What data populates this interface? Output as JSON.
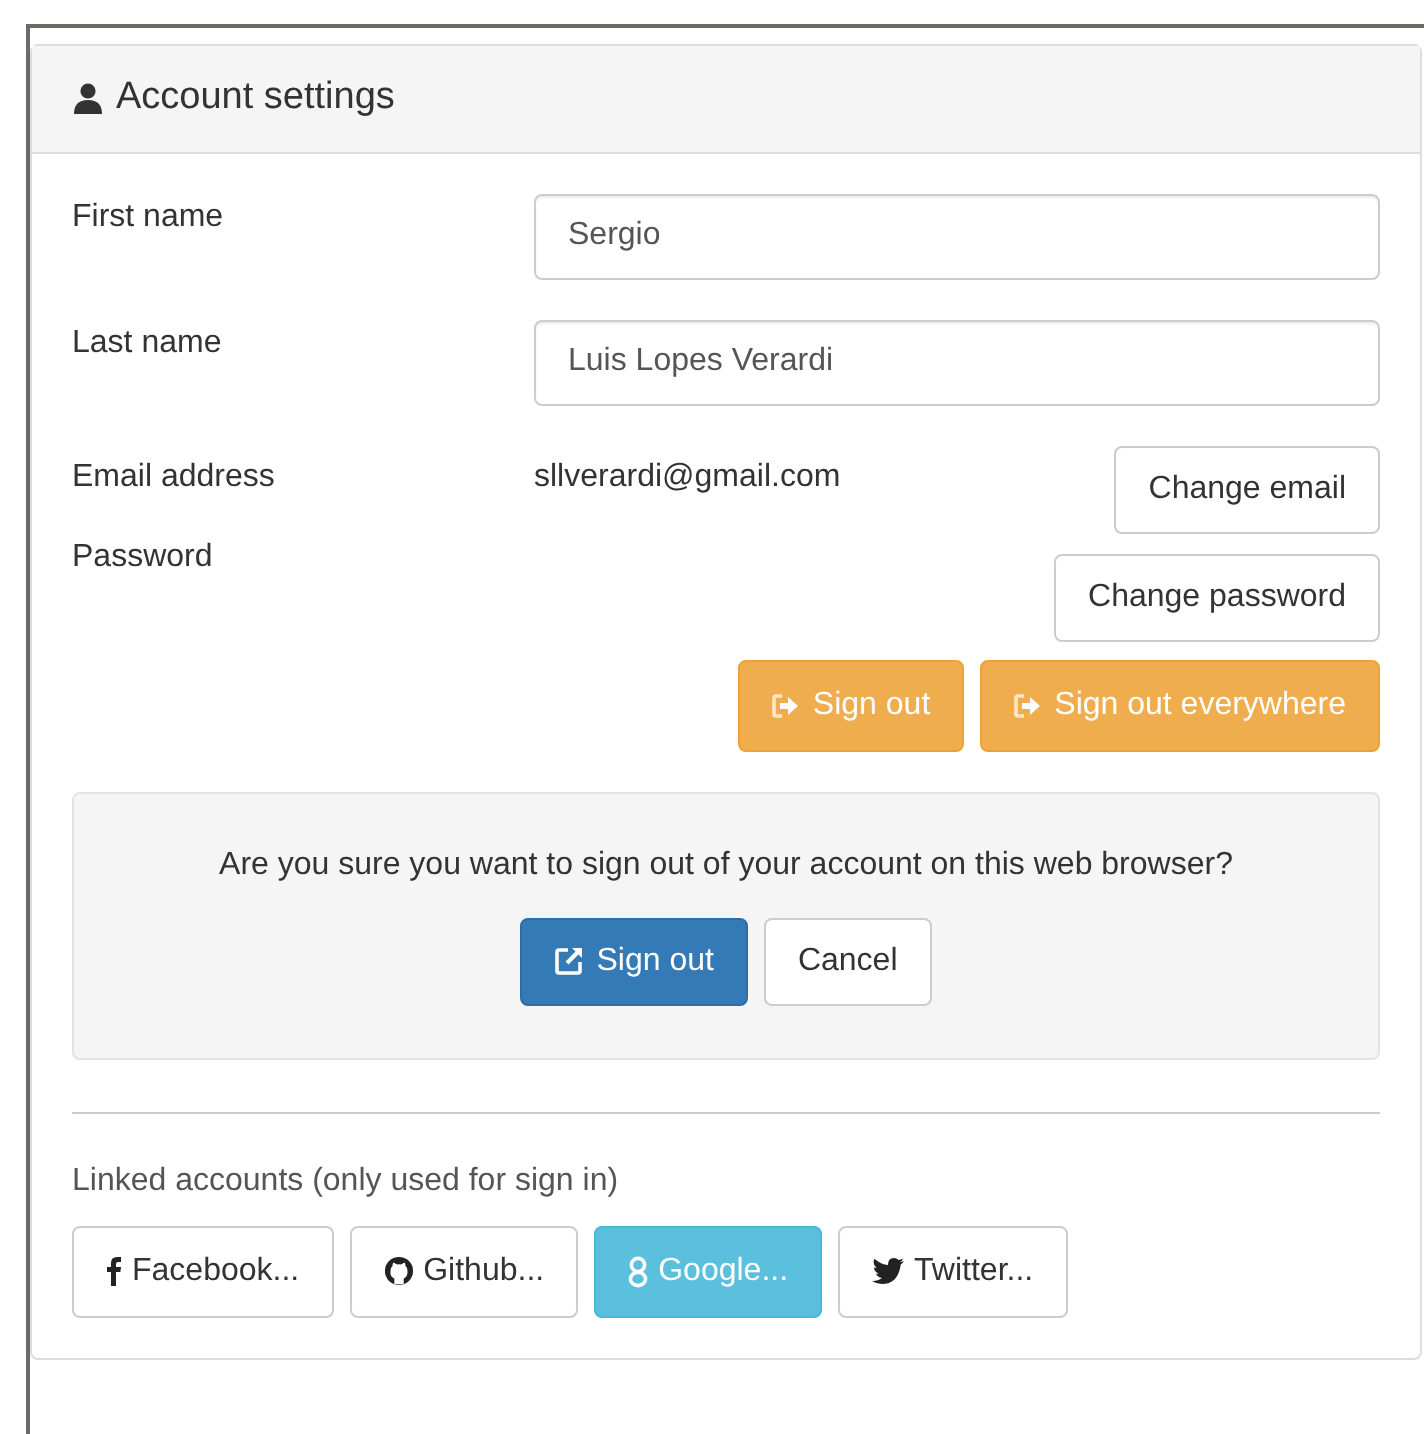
{
  "panel": {
    "title": "Account settings"
  },
  "fields": [
    {
      "label": "First name",
      "value": "Sergio"
    },
    {
      "label": "Last name",
      "value": "Luis Lopes Verardi"
    }
  ],
  "email": {
    "label": "Email address",
    "value": "sllverardi@gmail.com",
    "button": "Change email"
  },
  "password": {
    "label": "Password",
    "button": "Change password"
  },
  "sign_out_buttons": [
    "Sign out",
    "Sign out everywhere"
  ],
  "confirm": {
    "message": "Are you sure you want to sign out of your account on this web browser?",
    "confirm_button": "Sign out",
    "cancel_button": "Cancel"
  },
  "linked_accounts": {
    "label": "Linked accounts (only used for sign in)",
    "accounts": [
      {
        "kind": "facebook",
        "label": "Facebook...",
        "linked": false
      },
      {
        "kind": "github",
        "label": "Github...",
        "linked": false
      },
      {
        "kind": "google",
        "label": "Google...",
        "linked": true
      },
      {
        "kind": "twitter",
        "label": "Twitter...",
        "linked": false
      }
    ]
  }
}
